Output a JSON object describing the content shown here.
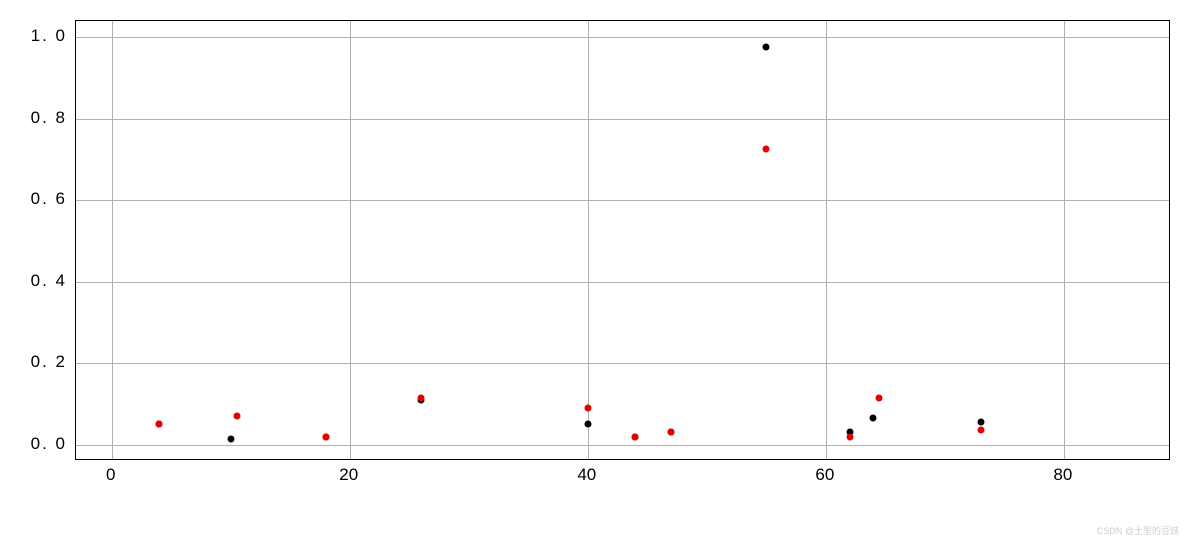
{
  "chart_data": {
    "type": "scatter",
    "xlim": [
      -3,
      89
    ],
    "ylim": [
      -0.04,
      1.04
    ],
    "xticks": [
      0,
      20,
      40,
      60,
      80
    ],
    "yticks": [
      0.0,
      0.2,
      0.4,
      0.6,
      0.8,
      1.0
    ],
    "ytick_labels": [
      "0. 0",
      "0. 2",
      "0. 4",
      "0. 6",
      "0. 8",
      "1. 0"
    ],
    "xtick_labels": [
      "0",
      "20",
      "40",
      "60",
      "80"
    ],
    "series": [
      {
        "name": "black",
        "color": "#000000",
        "points": [
          {
            "x": 4,
            "y": 0.05
          },
          {
            "x": 10,
            "y": 0.015
          },
          {
            "x": 18,
            "y": 0.02
          },
          {
            "x": 26,
            "y": 0.11
          },
          {
            "x": 40,
            "y": 0.05
          },
          {
            "x": 44,
            "y": 0.02
          },
          {
            "x": 47,
            "y": 0.03
          },
          {
            "x": 55,
            "y": 0.975
          },
          {
            "x": 62,
            "y": 0.03
          },
          {
            "x": 64,
            "y": 0.065
          },
          {
            "x": 73,
            "y": 0.055
          }
        ]
      },
      {
        "name": "red",
        "color": "#e60000",
        "points": [
          {
            "x": 4,
            "y": 0.05
          },
          {
            "x": 10.5,
            "y": 0.07
          },
          {
            "x": 18,
            "y": 0.02
          },
          {
            "x": 26,
            "y": 0.115
          },
          {
            "x": 40,
            "y": 0.09
          },
          {
            "x": 44,
            "y": 0.02
          },
          {
            "x": 47,
            "y": 0.03
          },
          {
            "x": 55,
            "y": 0.725
          },
          {
            "x": 62,
            "y": 0.02
          },
          {
            "x": 64.5,
            "y": 0.115
          },
          {
            "x": 73,
            "y": 0.035
          }
        ]
      }
    ],
    "title": "",
    "xlabel": "",
    "ylabel": ""
  },
  "watermark": "CSDN @土里的豆豉"
}
